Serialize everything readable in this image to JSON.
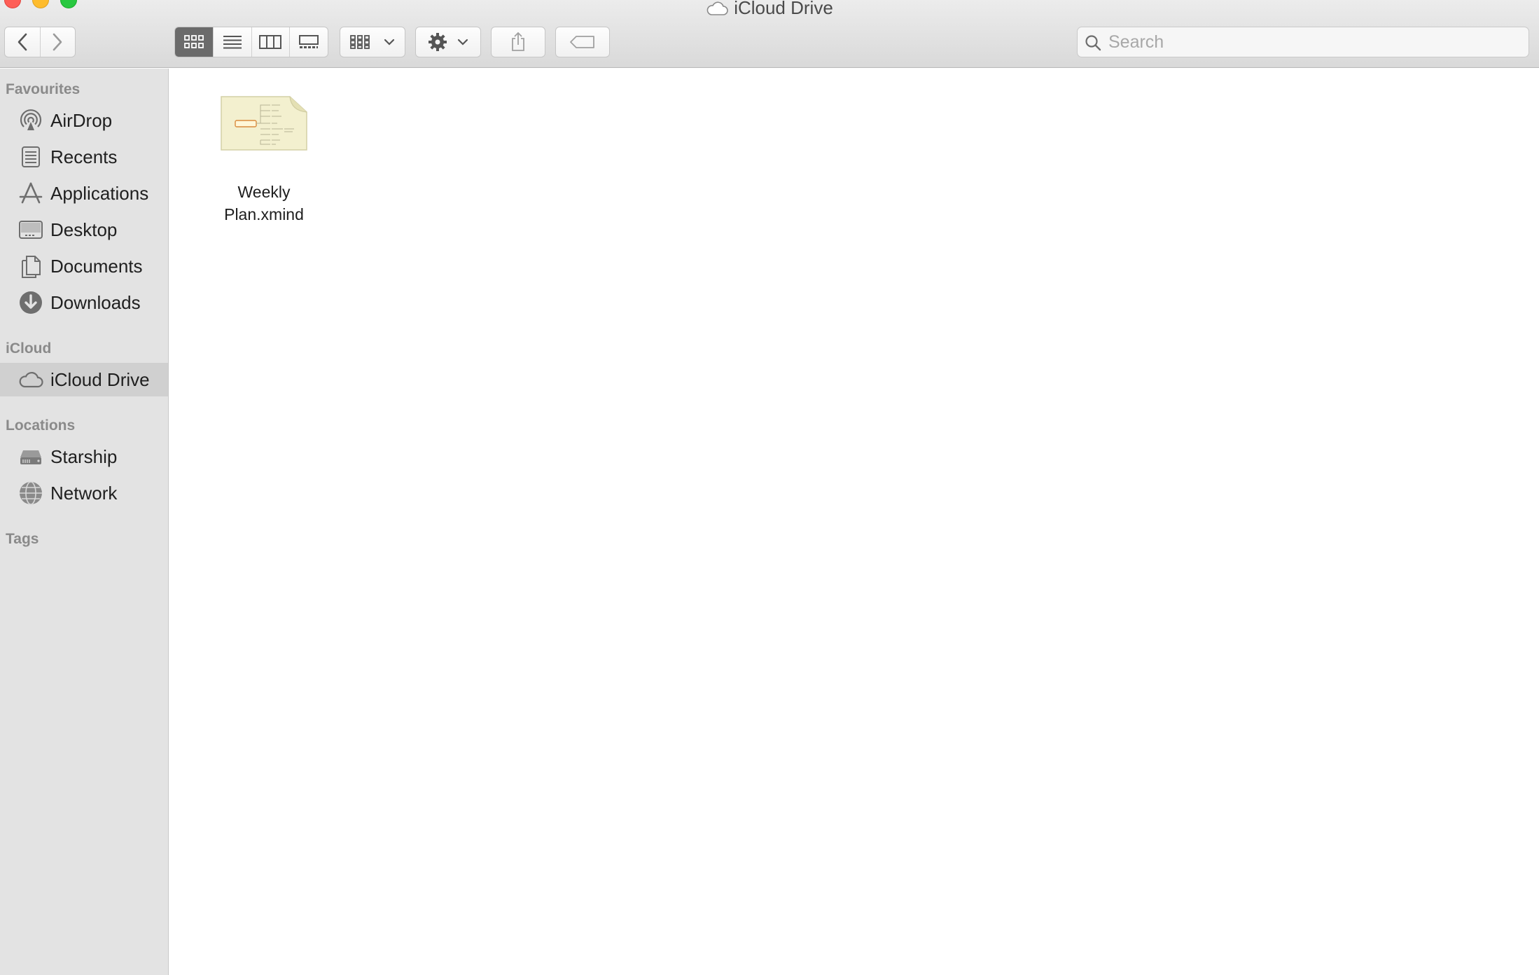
{
  "window": {
    "title": "iCloud Drive"
  },
  "toolbar": {
    "search_placeholder": "Search"
  },
  "sidebar": {
    "favourites_header": "Favourites",
    "favourites": [
      {
        "label": "AirDrop",
        "icon": "airdrop-icon"
      },
      {
        "label": "Recents",
        "icon": "recents-icon"
      },
      {
        "label": "Applications",
        "icon": "applications-icon"
      },
      {
        "label": "Desktop",
        "icon": "desktop-icon"
      },
      {
        "label": "Documents",
        "icon": "documents-icon"
      },
      {
        "label": "Downloads",
        "icon": "downloads-icon"
      }
    ],
    "icloud_header": "iCloud",
    "icloud": [
      {
        "label": "iCloud Drive",
        "icon": "cloud-icon",
        "selected": true
      }
    ],
    "locations_header": "Locations",
    "locations": [
      {
        "label": "Starship",
        "icon": "hard-drive-icon"
      },
      {
        "label": "Network",
        "icon": "network-globe-icon"
      }
    ],
    "tags_header": "Tags"
  },
  "content": {
    "files": [
      {
        "name_line1": "Weekly",
        "name_line2": "Plan.xmind",
        "icon": "xmind-file-icon"
      }
    ]
  },
  "colors": {
    "toolbar_bg": "#dcdcdc",
    "sidebar_bg": "#e3e3e3",
    "selection_bg": "#d0d0d0",
    "active_view_segment": "#6b6b6b"
  }
}
